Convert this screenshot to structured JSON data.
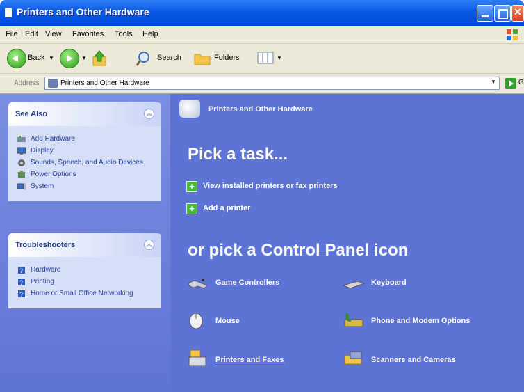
{
  "window": {
    "title": "Printers and Other Hardware"
  },
  "menubar": {
    "items": [
      "File",
      "Edit",
      "View",
      "Favorites",
      "Tools",
      "Help"
    ]
  },
  "toolbar": {
    "back_label": "Back",
    "search_label": "Search",
    "folders_label": "Folders"
  },
  "address": {
    "label": "Address",
    "value": "Printers and Other Hardware",
    "go_label": "Go"
  },
  "see_also": {
    "title": "See Also",
    "items": [
      "Add Hardware",
      "Display",
      "Sounds, Speech, and Audio Devices",
      "Power Options",
      "System"
    ]
  },
  "troubleshooters": {
    "title": "Troubleshooters",
    "items": [
      "Hardware",
      "Printing",
      "Home or Small Office Networking"
    ]
  },
  "main": {
    "header": "Printers and Other Hardware",
    "pick_task": "Pick a task...",
    "tasks": [
      "View installed printers or fax printers",
      "Add a printer"
    ],
    "or_pick": "or pick a Control Panel icon",
    "icons": [
      "Game Controllers",
      "Keyboard",
      "Mouse",
      "Phone and Modem Options",
      "Printers and Faxes",
      "Scanners and Cameras"
    ]
  },
  "colors": {
    "titlebar": "#0a59e6",
    "content_bg": "#5e73d6",
    "task_green": "#46b83a"
  }
}
